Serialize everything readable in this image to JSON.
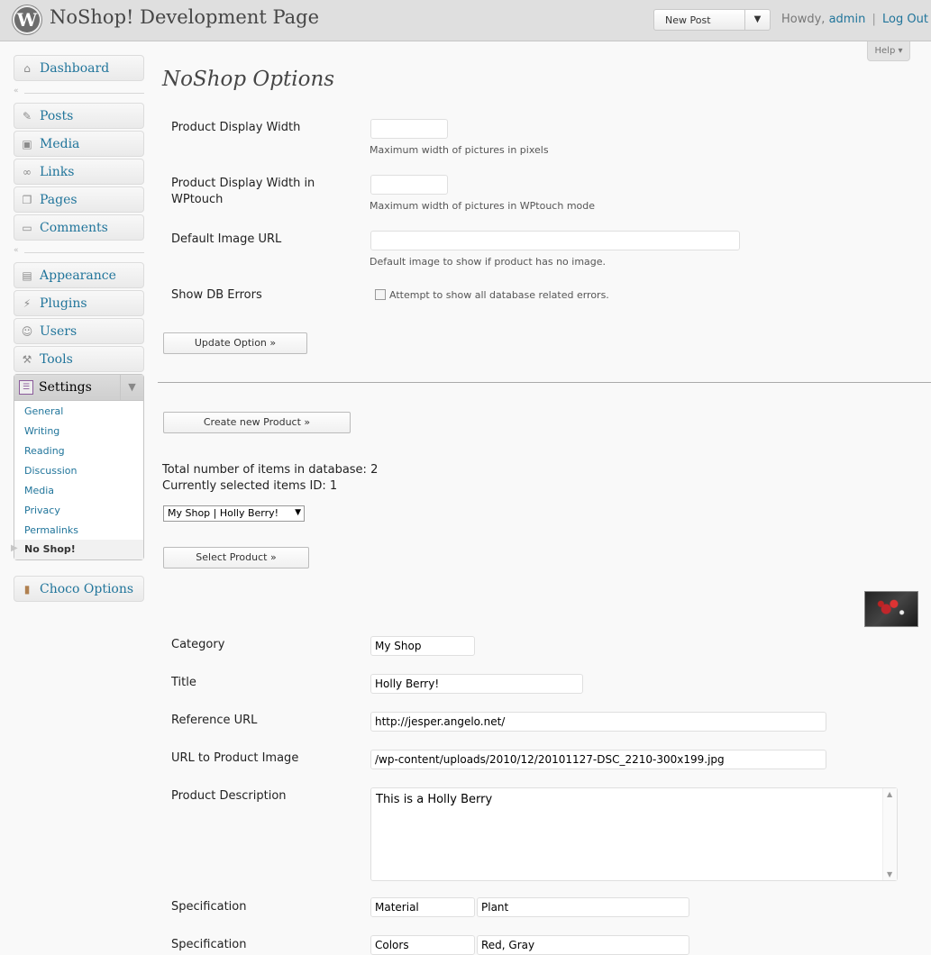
{
  "header": {
    "logo": "W",
    "site_title": "NoShop! Development Page",
    "new_post_label": "New Post",
    "howdy": "Howdy,",
    "user": "admin",
    "separator": "|",
    "logout": "Log Out",
    "help": "Help ▾"
  },
  "sidebar": {
    "dashboard": "Dashboard",
    "posts": "Posts",
    "media": "Media",
    "links": "Links",
    "pages": "Pages",
    "comments": "Comments",
    "appearance": "Appearance",
    "plugins": "Plugins",
    "users": "Users",
    "tools": "Tools",
    "settings": "Settings",
    "settings_sub": [
      "General",
      "Writing",
      "Reading",
      "Discussion",
      "Media",
      "Privacy",
      "Permalinks"
    ],
    "settings_current": "No Shop!",
    "choco": "Choco Options"
  },
  "options": {
    "title": "NoShop Options",
    "width_label": "Product Display Width",
    "width_value": "",
    "width_desc": "Maximum width of pictures in pixels",
    "wptouch_label": "Product Display Width in WPtouch",
    "wptouch_value": "",
    "wptouch_desc": "Maximum width of pictures in WPtouch mode",
    "image_url_label": "Default Image URL",
    "image_url_value": "",
    "image_url_desc": "Default image to show if product has no image.",
    "db_errors_label": "Show DB Errors",
    "db_errors_desc": "Attempt to show all database related errors.",
    "update_button": "Update Option »"
  },
  "products": {
    "create_button": "Create new Product »",
    "total_text": "Total number of items in database: 2",
    "selected_text": "Currently selected items ID: 1",
    "selected_option": "My Shop | Holly Berry!",
    "select_button": "Select Product »",
    "category_label": "Category",
    "category_value": "My Shop",
    "title_label": "Title",
    "title_value": "Holly Berry!",
    "ref_url_label": "Reference URL",
    "ref_url_value": "http://jesper.angelo.net/",
    "img_url_label": "URL to Product Image",
    "img_url_value": "/wp-content/uploads/2010/12/20101127-DSC_2210-300x199.jpg",
    "desc_label": "Product Description",
    "desc_value": "This is a Holly Berry",
    "spec1_label": "Specification",
    "spec1_key": "Material",
    "spec1_value": "Plant",
    "spec2_label": "Specification",
    "spec2_key": "Colors",
    "spec2_value": "Red, Gray"
  }
}
